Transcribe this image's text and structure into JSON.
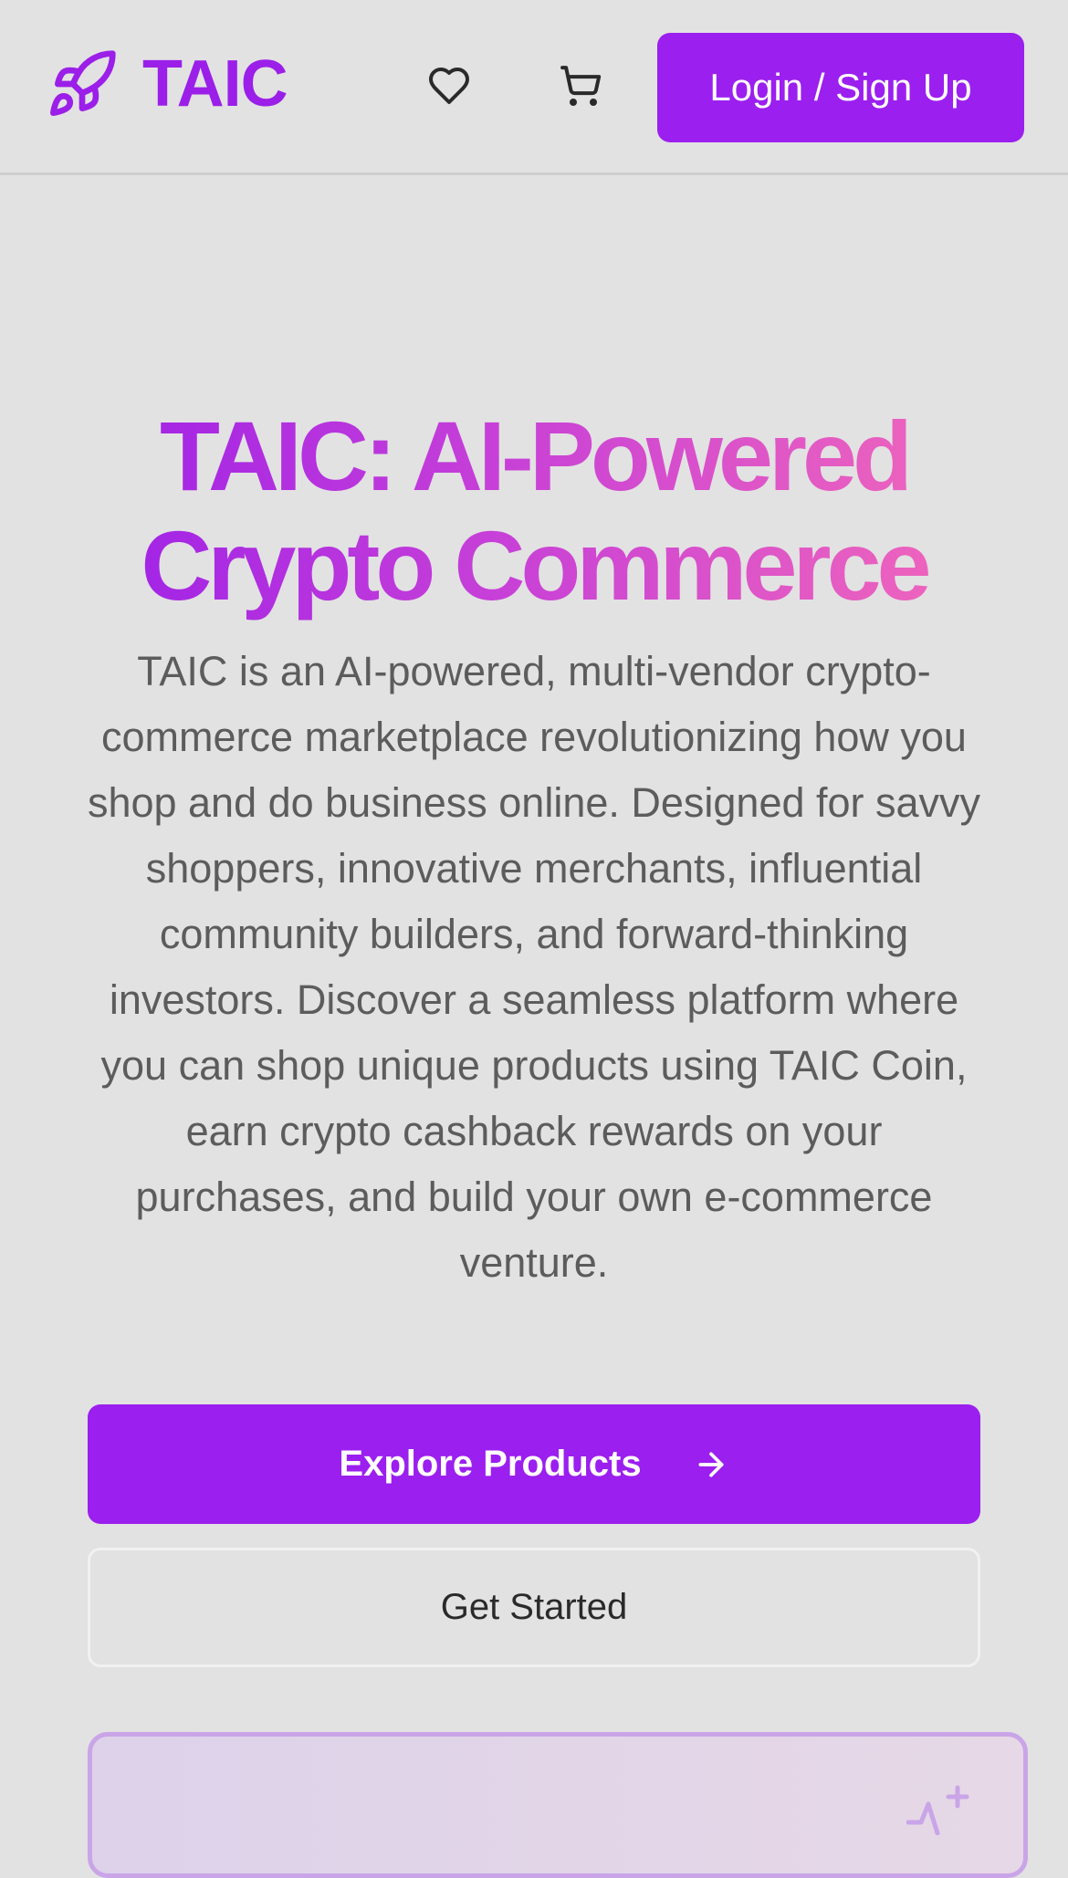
{
  "header": {
    "brand": "TAIC",
    "login_label": "Login / Sign Up",
    "icons": {
      "logo": "rocket-icon",
      "wishlist": "heart-icon",
      "cart": "shopping-cart-icon"
    }
  },
  "hero": {
    "title": "TAIC: AI-Powered Crypto Commerce",
    "description": "TAIC is an AI-powered, multi-vendor crypto-commerce marketplace revolutionizing how you shop and do business online. Designed for savvy shoppers, innovative merchants, influential community builders, and forward-thinking investors. Discover a seamless platform where you can shop unique products using TAIC Coin, earn crypto cashback rewards on your purchases, and build your own e-commerce venture.",
    "primary_cta": "Explore Products",
    "primary_cta_icon": "arrow-right-icon",
    "secondary_cta": "Get Started"
  },
  "promo_card": {
    "icon": "sparkle-activity-icon"
  },
  "colors": {
    "brand_purple": "#9b1fef",
    "gradient_start": "#9b1fe8",
    "gradient_end": "#f46ab8",
    "background": "#e2e2e2",
    "body_text": "#5c5c5c"
  }
}
